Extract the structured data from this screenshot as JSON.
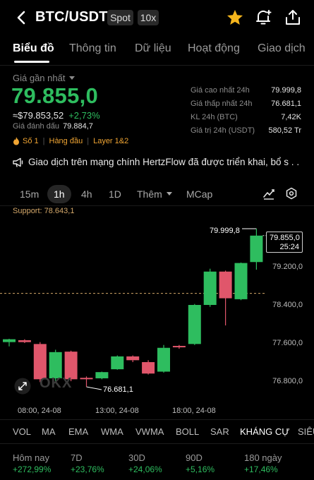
{
  "header": {
    "pair": "BTC/USDT",
    "market_type": "Spot",
    "leverage": "10x",
    "icons": [
      "back-icon",
      "star-icon",
      "alert-bell-icon",
      "share-icon"
    ],
    "star_color": "#f5b51c"
  },
  "tabs": [
    {
      "label": "Biểu đồ",
      "active": true
    },
    {
      "label": "Thông tin",
      "active": false
    },
    {
      "label": "Dữ liệu",
      "active": false
    },
    {
      "label": "Hoạt động",
      "active": false
    },
    {
      "label": "Giao dịch",
      "active": false
    }
  ],
  "price": {
    "last_label": "Giá gần nhất",
    "last": "79.855,0",
    "usd_value": "≈$79.853,52",
    "change": "+2,73%",
    "mark_label": "Giá đánh dấu",
    "mark_value": "79.884,7",
    "color": "#2ebd5f"
  },
  "stats": [
    {
      "label": "Giá cao nhất 24h",
      "value": "79.999,8"
    },
    {
      "label": "Giá thấp nhất 24h",
      "value": "76.681,1"
    },
    {
      "label": "KL 24h (BTC)",
      "value": "7,42K"
    },
    {
      "label": "Giá trị 24h (USDT)",
      "value": "580,52 Tr"
    }
  ],
  "tags": [
    "Số 1",
    "Hàng đầu",
    "Layer 1&2"
  ],
  "announcement": "Giao dịch trên mạng chính HertzFlow đã được triển khai, bổ s . .",
  "timeframes": {
    "items": [
      "15m",
      "1h",
      "4h",
      "1D"
    ],
    "active": "1h",
    "more": "Thêm",
    "mcap": "MCap"
  },
  "chart": {
    "support_label": "Support: 78.643,1",
    "current_price": "79.855,0",
    "countdown": "25:24",
    "high_annotation": "79.999,8",
    "low_annotation": "76.681,1",
    "watermark": "OKX",
    "up_color": "#2ebd5f",
    "down_color": "#e0566b",
    "support_color": "#d4a86a"
  },
  "chart_data": {
    "type": "candlestick",
    "y_ticks": [
      "79.200,0",
      "78.400,0",
      "77.600,0",
      "76.800,0"
    ],
    "x_ticks": [
      "08:00, 24-08",
      "13:00, 24-08",
      "18:00, 24-08"
    ],
    "ylim": [
      76500,
      80400
    ],
    "support": 78643.1,
    "candles": [
      {
        "o": 77620,
        "h": 77690,
        "l": 77530,
        "c": 77680
      },
      {
        "o": 77660,
        "h": 77680,
        "l": 77600,
        "c": 77620
      },
      {
        "o": 77580,
        "h": 77620,
        "l": 76780,
        "c": 76840
      },
      {
        "o": 76860,
        "h": 77460,
        "l": 76760,
        "c": 77410
      },
      {
        "o": 77420,
        "h": 77440,
        "l": 76800,
        "c": 76840
      },
      {
        "o": 76870,
        "h": 76900,
        "l": 76681.1,
        "c": 76850
      },
      {
        "o": 76860,
        "h": 77000,
        "l": 76840,
        "c": 76990
      },
      {
        "o": 77050,
        "h": 77340,
        "l": 77040,
        "c": 77320
      },
      {
        "o": 77320,
        "h": 77340,
        "l": 77200,
        "c": 77240
      },
      {
        "o": 77200,
        "h": 77240,
        "l": 76940,
        "c": 76960
      },
      {
        "o": 77000,
        "h": 77560,
        "l": 76980,
        "c": 77500
      },
      {
        "o": 77540,
        "h": 77560,
        "l": 77480,
        "c": 77520
      },
      {
        "o": 77580,
        "h": 78420,
        "l": 77560,
        "c": 78400
      },
      {
        "o": 78400,
        "h": 79160,
        "l": 78360,
        "c": 79100
      },
      {
        "o": 79100,
        "h": 79120,
        "l": 77970,
        "c": 78540
      },
      {
        "o": 78520,
        "h": 79290,
        "l": 78500,
        "c": 79280
      },
      {
        "o": 79300,
        "h": 79999.8,
        "l": 79140,
        "c": 79855
      }
    ]
  },
  "indicators": [
    "VOL",
    "MA",
    "EMA",
    "WMA",
    "VWMA",
    "BOLL",
    "SAR",
    "KHÁNG CỰ",
    "SIÊU"
  ],
  "active_indicator": "KHÁNG CỰ",
  "performance": [
    {
      "label": "Hôm nay",
      "value": "+272,99%"
    },
    {
      "label": "7D",
      "value": "+23,76%"
    },
    {
      "label": "30D",
      "value": "+24,06%"
    },
    {
      "label": "90D",
      "value": "+5,16%"
    },
    {
      "label": "180 ngày",
      "value": "+17,46%"
    }
  ]
}
